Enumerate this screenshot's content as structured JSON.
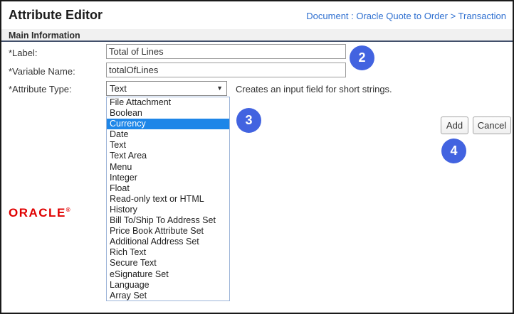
{
  "header": {
    "title": "Attribute Editor",
    "breadcrumb": "Document : Oracle Quote to Order > Transaction"
  },
  "section": {
    "title": "Main Information"
  },
  "form": {
    "label_field": {
      "label": "*Label:",
      "value": "Total of Lines"
    },
    "variable_field": {
      "label": "*Variable Name:",
      "value": "totalOfLines"
    },
    "type_field": {
      "label": "*Attribute Type:",
      "selected": "Text",
      "help": "Creates an input field for short strings."
    }
  },
  "dropdown": {
    "options": [
      "File Attachment",
      "Boolean",
      "Currency",
      "Date",
      "Text",
      "Text Area",
      "Menu",
      "Integer",
      "Float",
      "Read-only text or HTML",
      "History",
      "Bill To/Ship To Address Set",
      "Price Book Attribute Set",
      "Additional Address Set",
      "Rich Text",
      "Secure Text",
      "eSignature Set",
      "Language",
      "Array Set"
    ],
    "highlighted": "Currency"
  },
  "actions": {
    "add": "Add",
    "cancel": "Cancel"
  },
  "callouts": {
    "step2": "2",
    "step3": "3",
    "step4": "4"
  },
  "branding": {
    "logo_text": "ORACLE",
    "registered_mark": "®"
  },
  "colors": {
    "callout_blue": "#4263e0",
    "option_highlight_blue": "#1e86e8",
    "link_blue": "#2e6fd0",
    "oracle_red": "#e00000",
    "section_underline": "#42506b"
  }
}
